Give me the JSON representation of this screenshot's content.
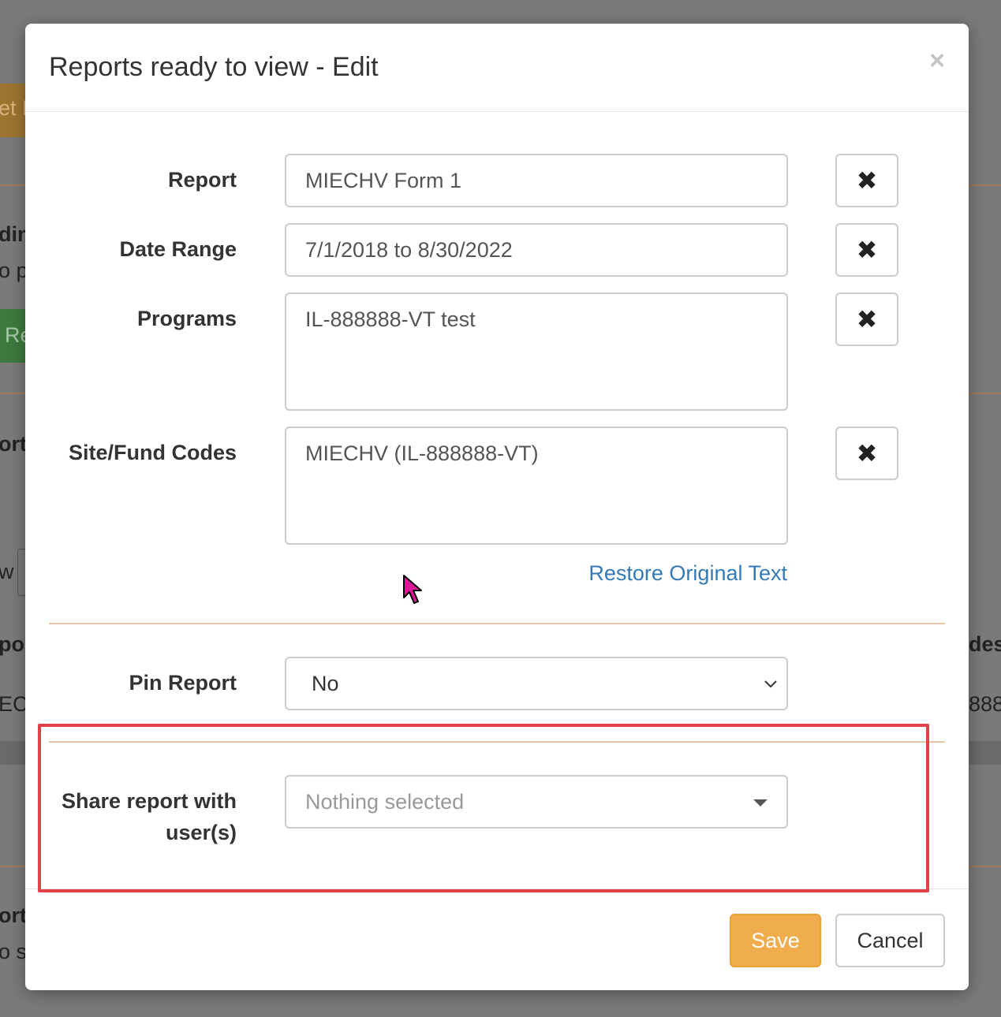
{
  "background": {
    "fragments": [
      "et F",
      "din",
      "o p",
      "Re",
      "ort",
      "w",
      "po",
      "EC",
      "des",
      "888",
      "ort",
      "o s"
    ]
  },
  "modal": {
    "title": "Reports ready to view - Edit",
    "close_symbol": "×",
    "fields": {
      "report": {
        "label": "Report",
        "value": "MIECHV Form 1"
      },
      "date_range": {
        "label": "Date Range",
        "value": "7/1/2018 to 8/30/2022"
      },
      "programs": {
        "label": "Programs",
        "value": "IL-888888-VT test"
      },
      "site_fund_codes": {
        "label": "Site/Fund Codes",
        "value": "MIECHV (IL-888888-VT)"
      }
    },
    "clear_symbol": "✖",
    "restore_link": "Restore Original Text",
    "pin_report": {
      "label": "Pin Report",
      "selected": "No"
    },
    "share": {
      "label_line1": "Share report with",
      "label_line2": "user(s)",
      "placeholder": "Nothing selected"
    },
    "footer": {
      "save_label": "Save",
      "cancel_label": "Cancel"
    }
  },
  "colors": {
    "accent_save": "#f0ad4e",
    "link": "#337ab7",
    "highlight": "#e3414a",
    "divider": "#e4c7a8",
    "cursor": "#e0169a"
  }
}
